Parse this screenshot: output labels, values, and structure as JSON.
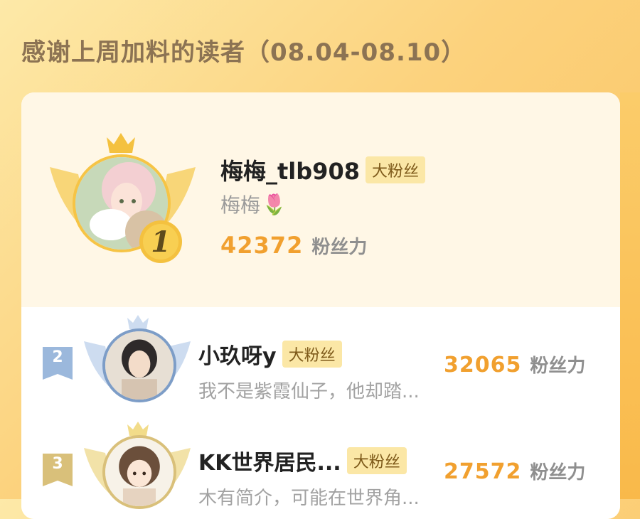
{
  "header": {
    "title": "感谢上周加料的读者（08.04-08.10）"
  },
  "top_fan": {
    "rank": "1",
    "name": "梅梅_tlb908",
    "badge": "大粉丝",
    "signature": "梅梅",
    "signature_emoji": "🌷",
    "score": "42372",
    "score_unit": "粉丝力"
  },
  "list": [
    {
      "rank": "2",
      "name": "小玖呀y",
      "badge": "大粉丝",
      "signature": "我不是紫霞仙子，他却踏...",
      "score": "32065",
      "score_unit": "粉丝力"
    },
    {
      "rank": "3",
      "name": "KK世界居民...",
      "badge": "大粉丝",
      "signature": "木有简介，可能在世界角...",
      "score": "27572",
      "score_unit": "粉丝力"
    }
  ],
  "colors": {
    "accent": "#f1a02f",
    "gold": "#f6c445",
    "silver": "#9bb8dc",
    "bronze": "#d9c07a"
  }
}
